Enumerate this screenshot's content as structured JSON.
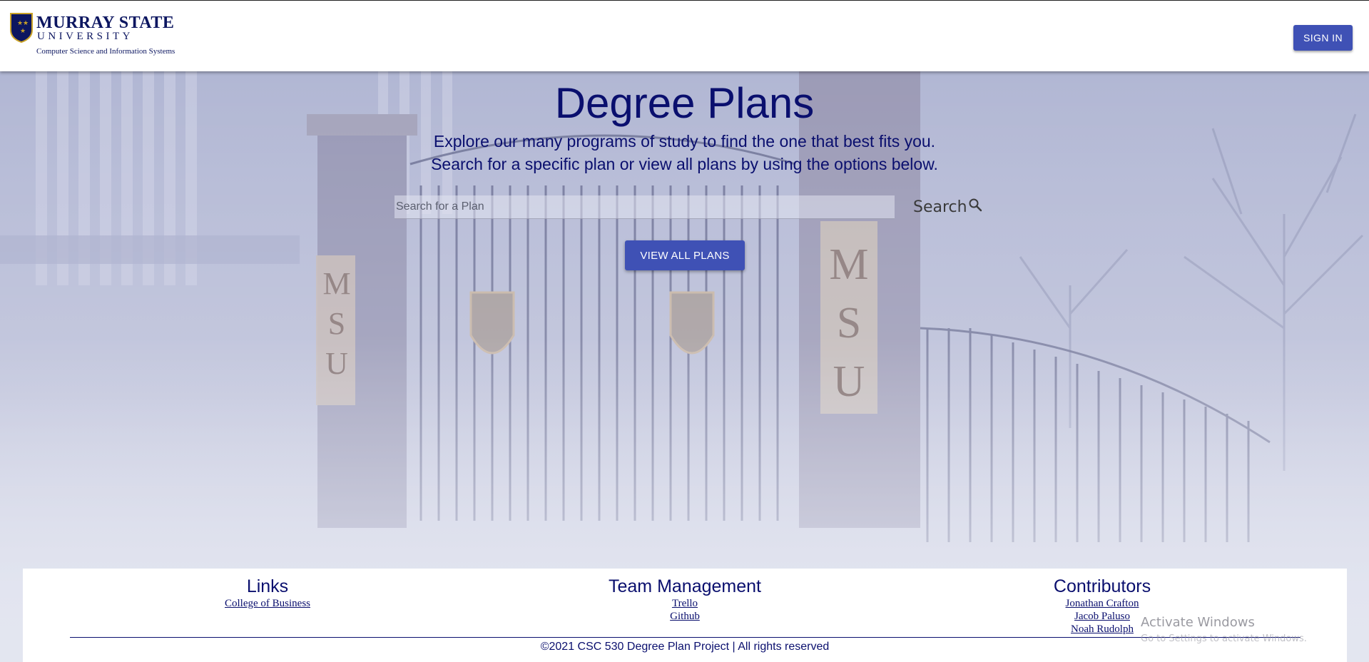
{
  "header": {
    "logo": {
      "name": "MURRAY STATE",
      "sub": "UNIVERSITY",
      "dept": "Computer Science and Information Systems"
    },
    "signin_label": "SIGN IN"
  },
  "hero": {
    "title": "Degree Plans",
    "line1": "Explore our many programs of study to find the one that best fits you.",
    "line2": "Search for a specific plan or view all plans by using the options below.",
    "search_placeholder": "Search for a Plan",
    "search_button_label": "Search",
    "view_all_label": "VIEW ALL PLANS",
    "background_banners": [
      "M",
      "S",
      "U"
    ]
  },
  "footer": {
    "links": {
      "title": "Links",
      "items": [
        "College of Business"
      ]
    },
    "team": {
      "title": "Team Management",
      "items": [
        "Trello",
        "Github"
      ]
    },
    "contributors": {
      "title": "Contributors",
      "items": [
        "Jonathan Crafton",
        "Jacob Paluso",
        "Noah Rudolph"
      ]
    },
    "copyright": "©2021 CSC 530 Degree Plan Project | All rights reserved"
  },
  "watermark": {
    "title": "Activate Windows",
    "subtitle": "Go to Settings to activate Windows."
  },
  "colors": {
    "navy": "#0a0f6e",
    "primary_button": "#3f51b5",
    "gold": "#c9a227"
  }
}
